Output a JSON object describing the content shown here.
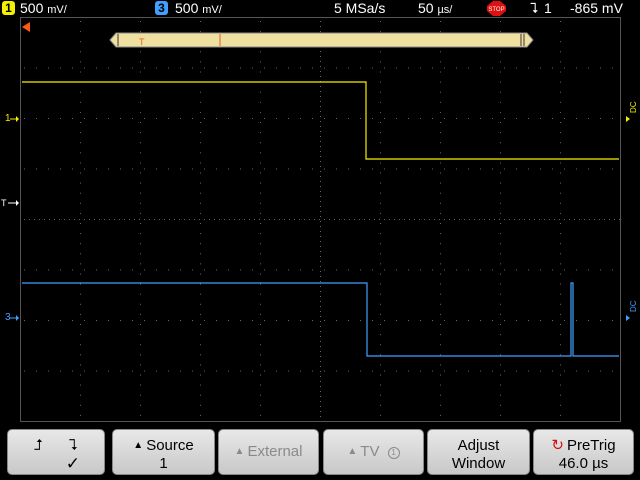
{
  "status": {
    "ch1_badge": "1",
    "ch1_scale": "500",
    "ch1_unit": "mV/",
    "ch3_badge": "3",
    "ch3_scale": "500",
    "ch3_unit": "mV/",
    "sample_rate": "5 MSa/s",
    "timebase": "50",
    "timebase_unit": "µs/",
    "run_state": "STOP",
    "trigger_source": "1",
    "trigger_level": "-865 mV"
  },
  "screen": {
    "trigger_marker_label": "T",
    "ch1_marker": "1",
    "ch3_marker": "3",
    "trig_level_marker": "T",
    "dc_label_1": "DC",
    "dc_label_3": "DC"
  },
  "softkeys": [
    {
      "line1": "",
      "line2": "✓",
      "symbols": "rising falling"
    },
    {
      "line1": "Source",
      "line2": "1",
      "enabled": true
    },
    {
      "line1": "External",
      "line2": "",
      "enabled": false
    },
    {
      "line1": "TV",
      "line2": "",
      "enabled": false
    },
    {
      "line1": "Adjust",
      "line2": "Window",
      "enabled": true
    },
    {
      "line1": "PreTrig",
      "line2": "46.0 µs",
      "enabled": true
    }
  ],
  "colors": {
    "ch1": "#f5f000",
    "ch3": "#3fa0ff",
    "trigger": "#ff5a14"
  }
}
